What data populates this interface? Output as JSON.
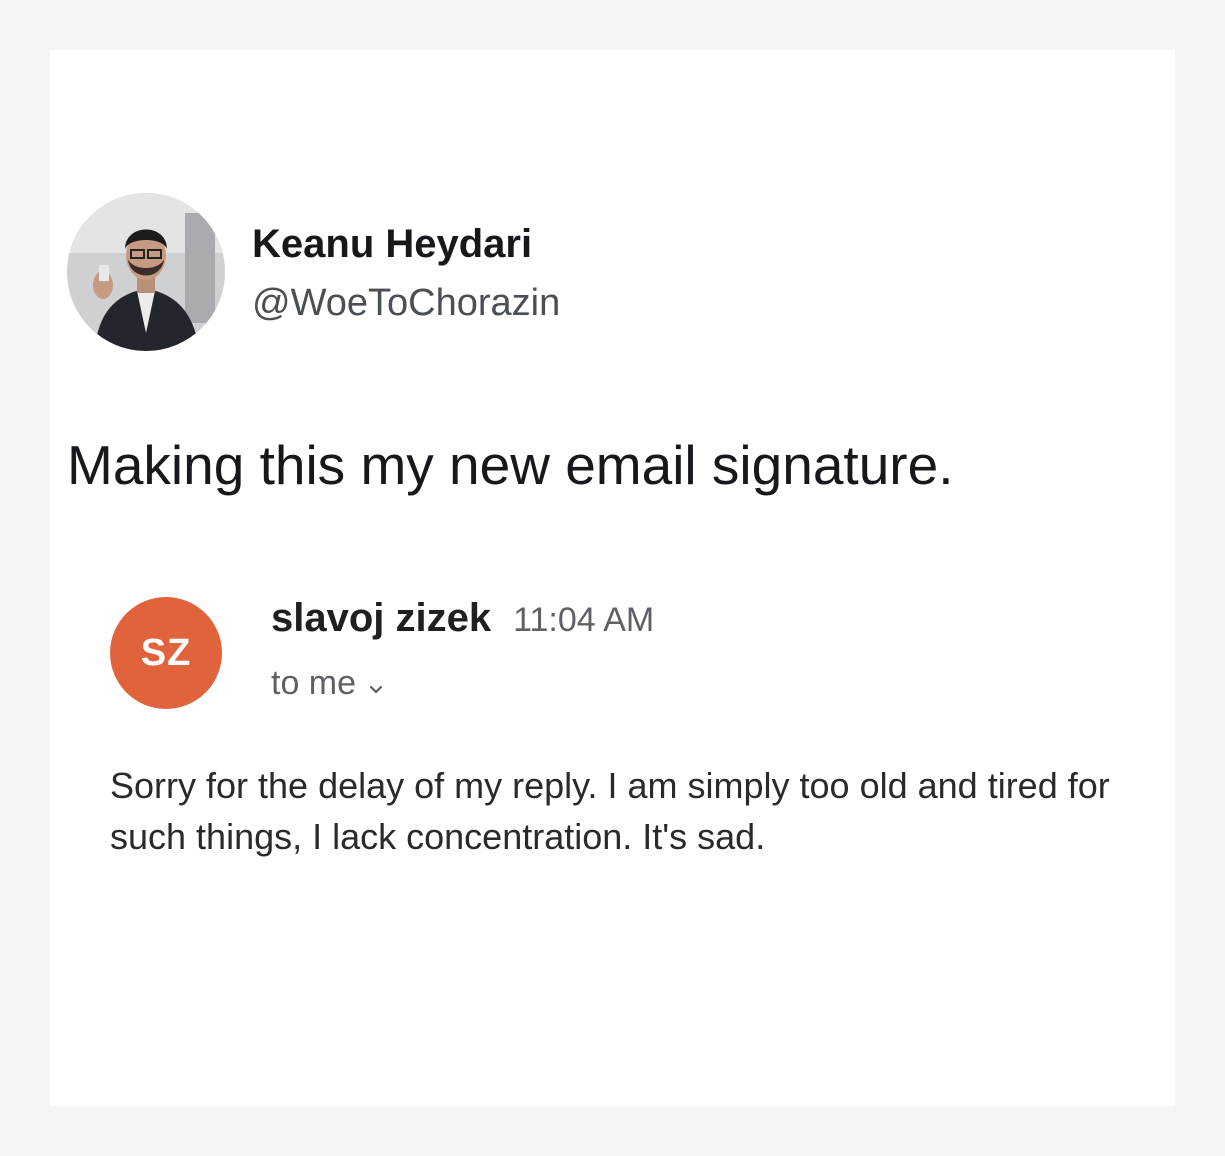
{
  "tweet": {
    "author_name": "Keanu Heydari",
    "author_handle": "@WoeToChorazin",
    "text": "Making this my new email signature."
  },
  "email": {
    "avatar_initials": "SZ",
    "avatar_color": "#e1633c",
    "sender": "slavoj zizek",
    "time": "11:04 AM",
    "recipient": "to me",
    "recipient_icon": "chevron-down-icon",
    "body": "Sorry for the delay of my reply. I am simply too old and tired for such things, I lack concentration. It's sad."
  }
}
